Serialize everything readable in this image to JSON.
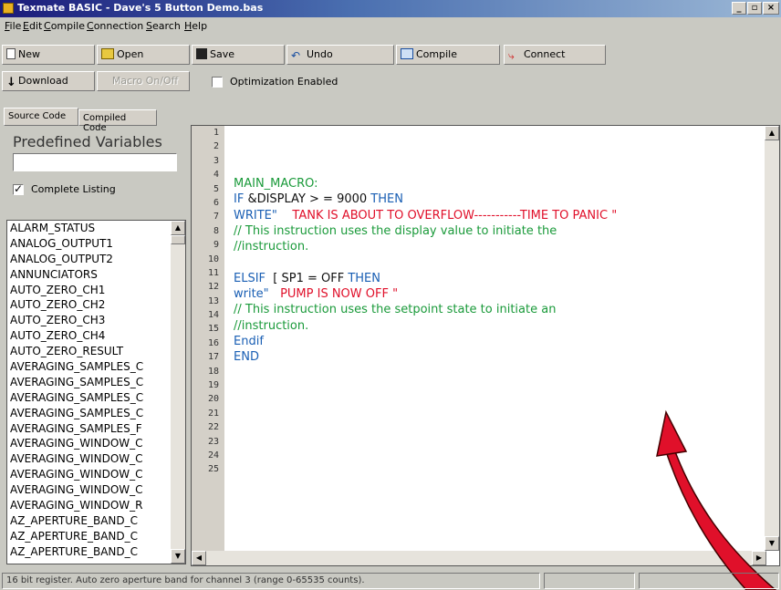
{
  "window": {
    "title": "Texmate BASIC - Dave's 5 Button Demo.bas",
    "controls": [
      "_",
      "▫",
      "×"
    ]
  },
  "menu": [
    "File",
    "Edit",
    "Compile",
    "Connection",
    "Search",
    "Help"
  ],
  "toolbar": {
    "new": "New",
    "open": "Open",
    "save": "Save",
    "undo": "Undo",
    "compile": "Compile",
    "connect": "Connect",
    "download": "Download",
    "macro": "Macro On/Off",
    "optimization": "Optimization Enabled"
  },
  "tabs": [
    "Source Code",
    "Compiled Code"
  ],
  "left": {
    "heading": "Predefined Variables",
    "search_value": "",
    "complete_listing": "Complete Listing",
    "variables": [
      "ALARM_STATUS",
      "ANALOG_OUTPUT1",
      "ANALOG_OUTPUT2",
      "ANNUNCIATORS",
      "AUTO_ZERO_CH1",
      "AUTO_ZERO_CH2",
      "AUTO_ZERO_CH3",
      "AUTO_ZERO_CH4",
      "AUTO_ZERO_RESULT",
      "AVERAGING_SAMPLES_C",
      "AVERAGING_SAMPLES_C",
      "AVERAGING_SAMPLES_C",
      "AVERAGING_SAMPLES_C",
      "AVERAGING_SAMPLES_F",
      "AVERAGING_WINDOW_C",
      "AVERAGING_WINDOW_C",
      "AVERAGING_WINDOW_C",
      "AVERAGING_WINDOW_C",
      "AVERAGING_WINDOW_R",
      "AZ_APERTURE_BAND_C",
      "AZ_APERTURE_BAND_C",
      "AZ_APERTURE_BAND_C"
    ]
  },
  "editor": {
    "line_numbers": [
      "1",
      "2",
      "3",
      "4",
      "5",
      "6",
      "7",
      "8",
      "9",
      "10",
      "11",
      "12",
      "13",
      "14",
      "15",
      "16",
      "17",
      "18",
      "19",
      "20",
      "21",
      "22",
      "23",
      "24",
      "25"
    ],
    "code": {
      "l1": "MAIN_MACRO:",
      "l2a": "IF",
      "l2b": " &DISPLAY > = 9000 ",
      "l2c": "THEN",
      "l3a": "WRITE\"",
      "l3b": "    TANK IS ABOUT TO OVERFLOW-----------TIME TO PANIC \"",
      "l4": "// This instruction uses the display value to initiate the",
      "l5": "//instruction.",
      "l6": "",
      "l7a": "ELSIF",
      "l7b": "  [ SP1 = OFF ",
      "l7c": "THEN",
      "l8a": "write\"",
      "l8b": "   PUMP IS NOW OFF \"",
      "l9": "// This instruction uses the setpoint state to initiate an",
      "l10": "//instruction.",
      "l11": "Endif",
      "l12": "END"
    }
  },
  "status": {
    "message": "16 bit register. Auto zero aperture band for channel 3 (range 0-65535 counts)."
  },
  "colors": {
    "accent_arrow": "#e0102a"
  }
}
